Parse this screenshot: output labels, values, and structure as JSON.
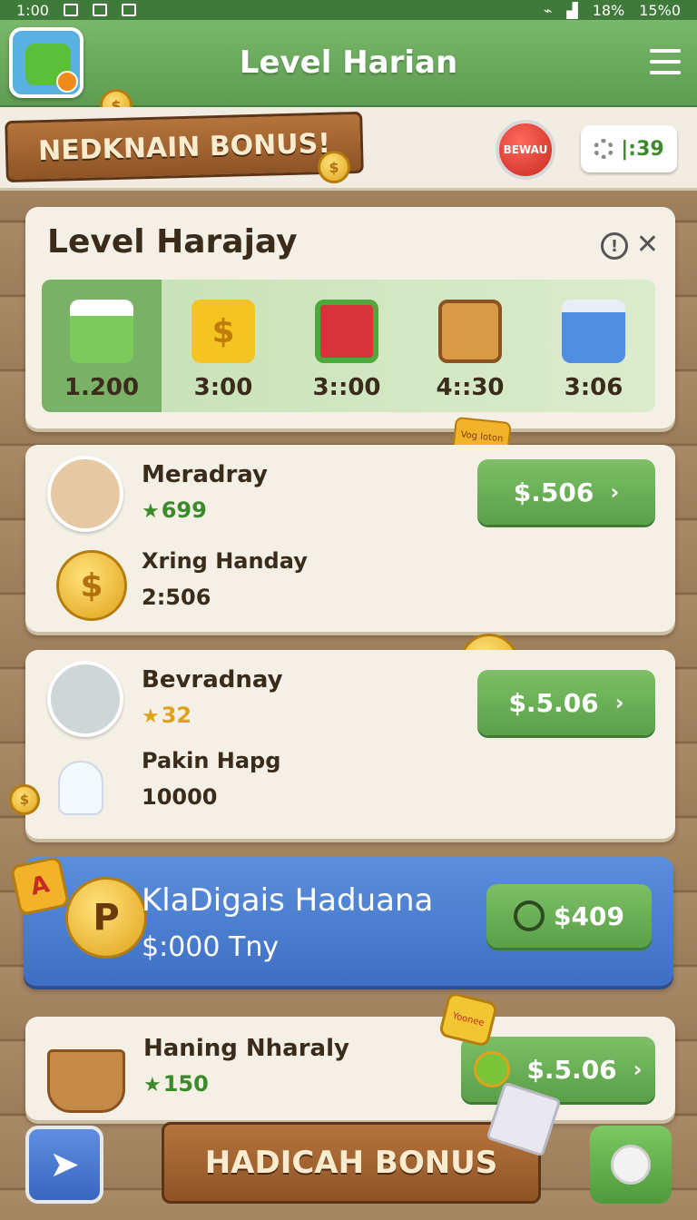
{
  "status_bar": {
    "time": "1:00",
    "battery": "18%",
    "right_value": "15%0"
  },
  "header": {
    "title": "Level Harian",
    "avatar_icon": "green-cube-icon",
    "menu_icon": "hamburger-icon"
  },
  "top_strip": {
    "sign_text": "NEDKNAIN BONUS!",
    "red_button_label": "BEWAU",
    "timer": "|:39"
  },
  "level_panel": {
    "title": "Level Harajay",
    "rewards": [
      {
        "icon": "cake-cube-icon",
        "value": "1.200",
        "color": "#7cc95c"
      },
      {
        "icon": "dollar-cube-icon",
        "value": "3:00",
        "color": "#f4c522"
      },
      {
        "icon": "gift-box-icon",
        "value": "3::00",
        "color": "#d6333b"
      },
      {
        "icon": "treasure-chest-icon",
        "value": "4::30",
        "color": "#d99a48"
      },
      {
        "icon": "blue-cart-icon",
        "value": "3:06",
        "color": "#4f8ee0"
      }
    ]
  },
  "rows": [
    {
      "name": "Meradray",
      "stat": "699",
      "stat_icon": "green-star-icon",
      "sub_name": "Xring Handay",
      "sub_value": "2:506",
      "button": "$.506",
      "avatar_icon": "boy-avatar-icon",
      "sub_icon": "gold-coin-icon",
      "badge": "Vog loton"
    },
    {
      "name": "Bevradnay",
      "stat": "32",
      "stat_icon": "gold-star-icon",
      "sub_name": "Pakin Hapg",
      "sub_value": "10000",
      "button": "$.5.06",
      "avatar_icon": "teacup-icon",
      "sub_icon": "ghost-icon"
    }
  ],
  "promo": {
    "title": "KlaDigais Haduana",
    "subtitle": "$:000 Tny",
    "button": "$409",
    "coin_letter": "P"
  },
  "last_row": {
    "name": "Haning Nharaly",
    "stat": "150",
    "stat_icon": "green-star-icon",
    "button": "$.5.06",
    "badge": "Yoonee"
  },
  "bottom_bar": {
    "sign_text": "HADICAH BONUS"
  },
  "colors": {
    "accent_green": "#5aa048",
    "promo_blue": "#3f6fc4",
    "wood": "#8e5426"
  }
}
